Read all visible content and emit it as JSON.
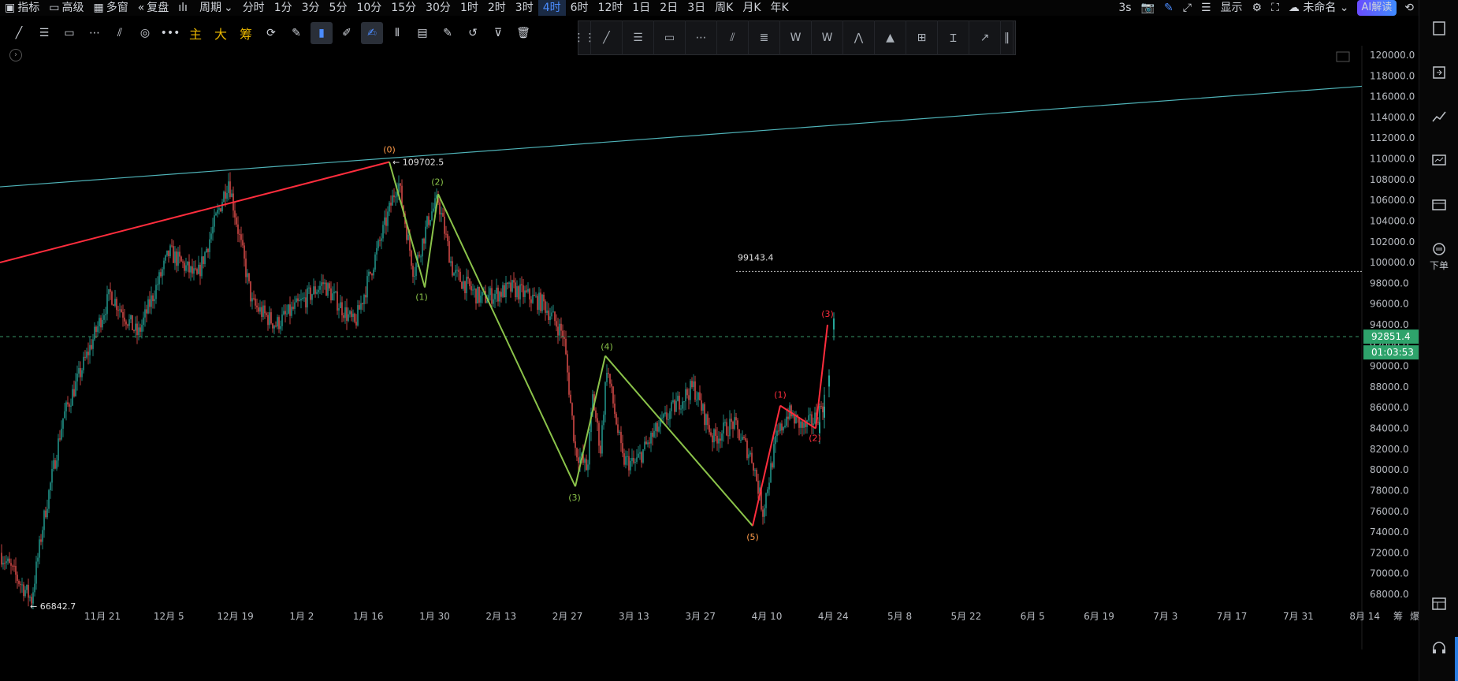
{
  "topbar": {
    "items": [
      {
        "label": "指标",
        "icon": "indicator-icon"
      },
      {
        "label": "高级",
        "icon": "calendar-icon"
      },
      {
        "label": "多窗",
        "icon": "grid-icon"
      },
      {
        "label": "复盘",
        "icon": "rewind-icon"
      },
      {
        "label": "",
        "icon": "chart-type-icon"
      },
      {
        "label": "周期",
        "icon": "chevron-down-icon"
      }
    ],
    "timeframes": [
      "分时",
      "1分",
      "3分",
      "5分",
      "10分",
      "15分",
      "30分",
      "1时",
      "2时",
      "3时",
      "4时",
      "6时",
      "12时",
      "1日",
      "2日",
      "3日",
      "周K",
      "月K",
      "年K"
    ],
    "active_timeframe": "4时",
    "right": {
      "refresh": "3s",
      "display": "显示",
      "layout": "未命名",
      "ai": "AI解读"
    }
  },
  "toolbar2": {
    "labels": {
      "main": "主",
      "big": "大",
      "chip": "筹"
    }
  },
  "rightrail": {
    "order_label": "下单"
  },
  "chart_data": {
    "type": "candlestick",
    "symbol_level_lines": [
      {
        "label": "99143.4",
        "value": 99143.4
      }
    ],
    "current_price": "92851.4",
    "countdown": "01:03:53",
    "high_marker": "109702.5",
    "low_marker": "66842.7",
    "y_axis": {
      "ticks": [
        68000,
        70000,
        72000,
        74000,
        76000,
        78000,
        80000,
        82000,
        84000,
        86000,
        88000,
        90000,
        92000,
        94000,
        96000,
        98000,
        100000,
        102000,
        104000,
        106000,
        108000,
        110000,
        112000,
        114000,
        116000,
        118000,
        120000
      ],
      "range": [
        66500,
        121000
      ]
    },
    "x_axis": {
      "ticks": [
        "11月 21",
        "12月 5",
        "12月 19",
        "1月 2",
        "1月 16",
        "1月 30",
        "2月 13",
        "2月 27",
        "3月 13",
        "3月 27",
        "4月 10",
        "4月 24",
        "5月 8",
        "5月 22",
        "6月 5",
        "6月 19",
        "7月 3",
        "7月 17",
        "7月 31",
        "8月 14"
      ],
      "extra": [
        "筹",
        "爆"
      ]
    },
    "wave_labels_green": [
      "(0)",
      "(1)",
      "(2)",
      "(3)",
      "(4)",
      "(5)"
    ],
    "wave_labels_red": [
      "(1)",
      "(2)",
      "(3)"
    ],
    "colors": {
      "up": "#26a69a",
      "down": "#ef5350",
      "green_wave": "#8bc34a",
      "red_line": "#ff2d3d",
      "cyan_line": "#4fb3b8",
      "wave_label_orange": "#ff9b4a"
    }
  }
}
